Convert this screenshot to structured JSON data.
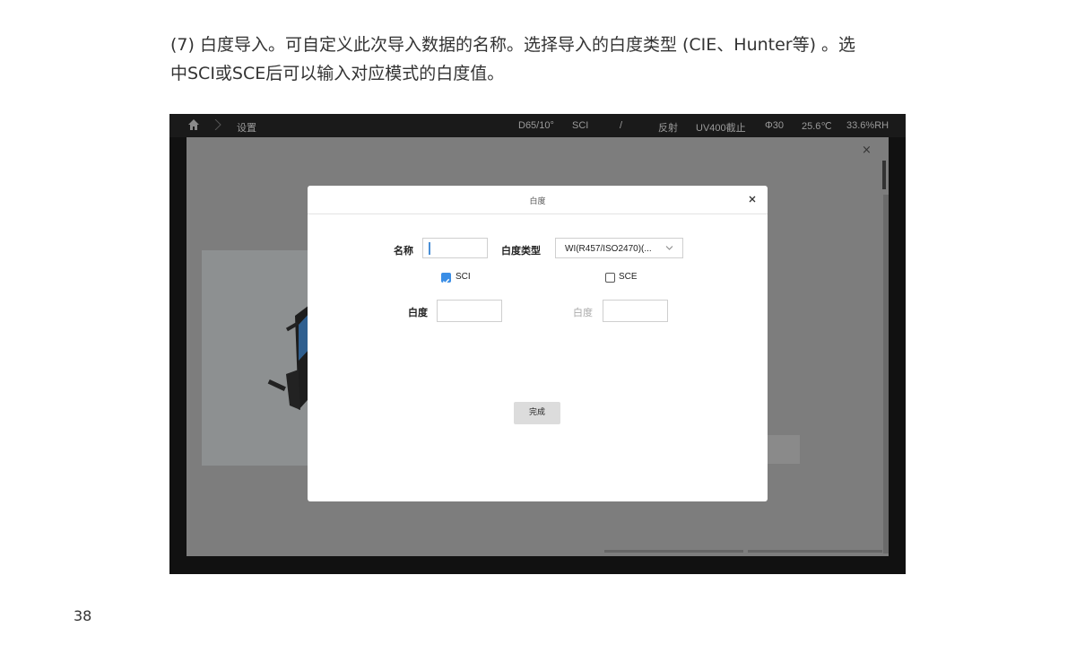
{
  "doc": {
    "intro_line1": "(7) 白度导入。可自定义此次导入数据的名称。选择导入的白度类型 (CIE、Hunter等) 。选",
    "intro_line2": "中SCI或SCE后可以输入对应模式的白度值。",
    "page_number": "38"
  },
  "statusbar": {
    "breadcrumb": "设置",
    "illuminant": "D65/10°",
    "mode": "SCI",
    "separator": "/",
    "measure": "反射",
    "uv": "UV400截止",
    "aperture": "Φ30",
    "temperature": "25.6℃",
    "humidity": "33.6%RH"
  },
  "outer": {
    "close_label": "×"
  },
  "dialog": {
    "title": "白度",
    "name_label": "名称",
    "name_value": "",
    "type_label": "白度类型",
    "type_value": "WI(R457/ISO2470)(...",
    "sci_label": "SCI",
    "sci_checked": true,
    "sce_label": "SCE",
    "sce_checked": false,
    "sci_whiteness_label": "白度",
    "sce_whiteness_label": "白度",
    "done_label": "完成"
  },
  "colors": {
    "accent": "#3a8ee6",
    "overlay": "#7d7d7d",
    "statusbar": "#1a1a1a"
  }
}
